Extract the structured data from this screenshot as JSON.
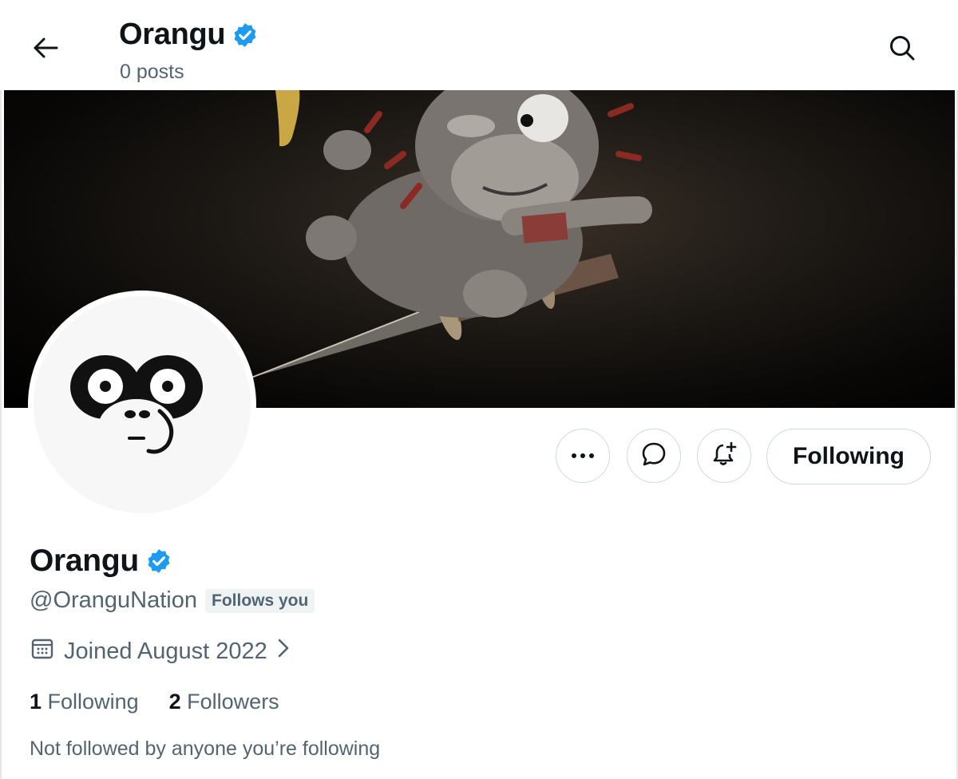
{
  "header": {
    "title": "Orangu",
    "subtitle": "0 posts",
    "back_icon": "arrow-left-icon",
    "search_icon": "search-icon"
  },
  "banner": {
    "description_icon": "banner-image"
  },
  "actions": {
    "more_icon": "more-horizontal-icon",
    "message_icon": "message-bubble-icon",
    "notify_icon": "bell-plus-icon",
    "following_label": "Following"
  },
  "profile": {
    "name": "Orangu",
    "handle": "@OranguNation",
    "follows_you": "Follows you",
    "joined": "Joined August 2022",
    "following_count": "1",
    "following_label": "Following",
    "followers_count": "2",
    "followers_label": "Followers",
    "mutuals_note": "Not followed by anyone you’re following"
  },
  "colors": {
    "verified": "#1d9bf0",
    "secondary_text": "#536471",
    "border": "#cfd9de"
  }
}
